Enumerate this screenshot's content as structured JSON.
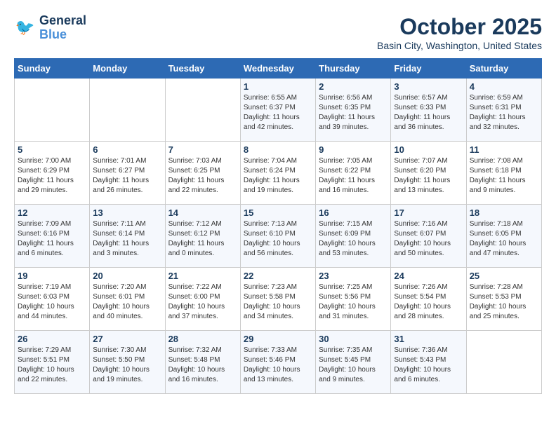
{
  "header": {
    "logo_line1": "General",
    "logo_line2": "Blue",
    "month": "October 2025",
    "location": "Basin City, Washington, United States"
  },
  "weekdays": [
    "Sunday",
    "Monday",
    "Tuesday",
    "Wednesday",
    "Thursday",
    "Friday",
    "Saturday"
  ],
  "weeks": [
    [
      {
        "day": "",
        "info": ""
      },
      {
        "day": "",
        "info": ""
      },
      {
        "day": "",
        "info": ""
      },
      {
        "day": "1",
        "info": "Sunrise: 6:55 AM\nSunset: 6:37 PM\nDaylight: 11 hours\nand 42 minutes."
      },
      {
        "day": "2",
        "info": "Sunrise: 6:56 AM\nSunset: 6:35 PM\nDaylight: 11 hours\nand 39 minutes."
      },
      {
        "day": "3",
        "info": "Sunrise: 6:57 AM\nSunset: 6:33 PM\nDaylight: 11 hours\nand 36 minutes."
      },
      {
        "day": "4",
        "info": "Sunrise: 6:59 AM\nSunset: 6:31 PM\nDaylight: 11 hours\nand 32 minutes."
      }
    ],
    [
      {
        "day": "5",
        "info": "Sunrise: 7:00 AM\nSunset: 6:29 PM\nDaylight: 11 hours\nand 29 minutes."
      },
      {
        "day": "6",
        "info": "Sunrise: 7:01 AM\nSunset: 6:27 PM\nDaylight: 11 hours\nand 26 minutes."
      },
      {
        "day": "7",
        "info": "Sunrise: 7:03 AM\nSunset: 6:25 PM\nDaylight: 11 hours\nand 22 minutes."
      },
      {
        "day": "8",
        "info": "Sunrise: 7:04 AM\nSunset: 6:24 PM\nDaylight: 11 hours\nand 19 minutes."
      },
      {
        "day": "9",
        "info": "Sunrise: 7:05 AM\nSunset: 6:22 PM\nDaylight: 11 hours\nand 16 minutes."
      },
      {
        "day": "10",
        "info": "Sunrise: 7:07 AM\nSunset: 6:20 PM\nDaylight: 11 hours\nand 13 minutes."
      },
      {
        "day": "11",
        "info": "Sunrise: 7:08 AM\nSunset: 6:18 PM\nDaylight: 11 hours\nand 9 minutes."
      }
    ],
    [
      {
        "day": "12",
        "info": "Sunrise: 7:09 AM\nSunset: 6:16 PM\nDaylight: 11 hours\nand 6 minutes."
      },
      {
        "day": "13",
        "info": "Sunrise: 7:11 AM\nSunset: 6:14 PM\nDaylight: 11 hours\nand 3 minutes."
      },
      {
        "day": "14",
        "info": "Sunrise: 7:12 AM\nSunset: 6:12 PM\nDaylight: 11 hours\nand 0 minutes."
      },
      {
        "day": "15",
        "info": "Sunrise: 7:13 AM\nSunset: 6:10 PM\nDaylight: 10 hours\nand 56 minutes."
      },
      {
        "day": "16",
        "info": "Sunrise: 7:15 AM\nSunset: 6:09 PM\nDaylight: 10 hours\nand 53 minutes."
      },
      {
        "day": "17",
        "info": "Sunrise: 7:16 AM\nSunset: 6:07 PM\nDaylight: 10 hours\nand 50 minutes."
      },
      {
        "day": "18",
        "info": "Sunrise: 7:18 AM\nSunset: 6:05 PM\nDaylight: 10 hours\nand 47 minutes."
      }
    ],
    [
      {
        "day": "19",
        "info": "Sunrise: 7:19 AM\nSunset: 6:03 PM\nDaylight: 10 hours\nand 44 minutes."
      },
      {
        "day": "20",
        "info": "Sunrise: 7:20 AM\nSunset: 6:01 PM\nDaylight: 10 hours\nand 40 minutes."
      },
      {
        "day": "21",
        "info": "Sunrise: 7:22 AM\nSunset: 6:00 PM\nDaylight: 10 hours\nand 37 minutes."
      },
      {
        "day": "22",
        "info": "Sunrise: 7:23 AM\nSunset: 5:58 PM\nDaylight: 10 hours\nand 34 minutes."
      },
      {
        "day": "23",
        "info": "Sunrise: 7:25 AM\nSunset: 5:56 PM\nDaylight: 10 hours\nand 31 minutes."
      },
      {
        "day": "24",
        "info": "Sunrise: 7:26 AM\nSunset: 5:54 PM\nDaylight: 10 hours\nand 28 minutes."
      },
      {
        "day": "25",
        "info": "Sunrise: 7:28 AM\nSunset: 5:53 PM\nDaylight: 10 hours\nand 25 minutes."
      }
    ],
    [
      {
        "day": "26",
        "info": "Sunrise: 7:29 AM\nSunset: 5:51 PM\nDaylight: 10 hours\nand 22 minutes."
      },
      {
        "day": "27",
        "info": "Sunrise: 7:30 AM\nSunset: 5:50 PM\nDaylight: 10 hours\nand 19 minutes."
      },
      {
        "day": "28",
        "info": "Sunrise: 7:32 AM\nSunset: 5:48 PM\nDaylight: 10 hours\nand 16 minutes."
      },
      {
        "day": "29",
        "info": "Sunrise: 7:33 AM\nSunset: 5:46 PM\nDaylight: 10 hours\nand 13 minutes."
      },
      {
        "day": "30",
        "info": "Sunrise: 7:35 AM\nSunset: 5:45 PM\nDaylight: 10 hours\nand 9 minutes."
      },
      {
        "day": "31",
        "info": "Sunrise: 7:36 AM\nSunset: 5:43 PM\nDaylight: 10 hours\nand 6 minutes."
      },
      {
        "day": "",
        "info": ""
      }
    ]
  ]
}
